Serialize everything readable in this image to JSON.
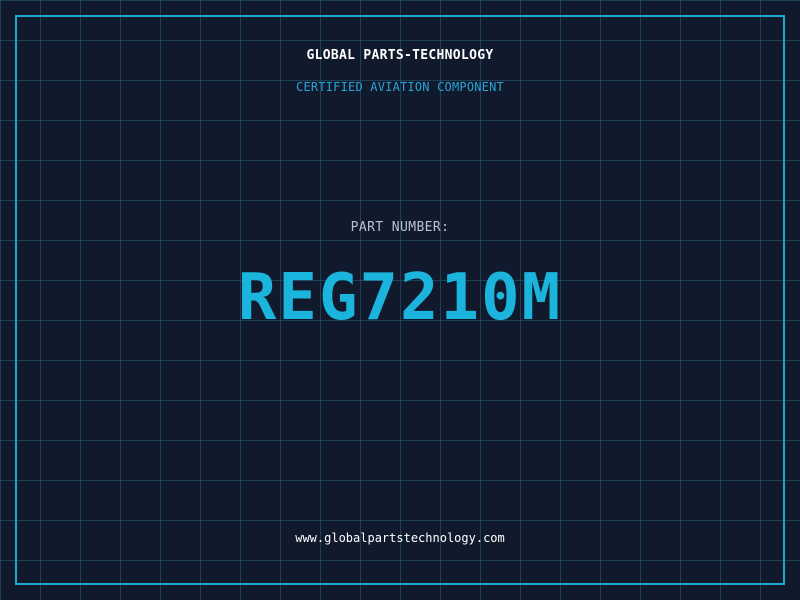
{
  "header": {
    "company": "GLOBAL PARTS-TECHNOLOGY",
    "tagline": "CERTIFIED AVIATION COMPONENT"
  },
  "part": {
    "label": "PART NUMBER:",
    "number": "REG7210M"
  },
  "footer": {
    "url": "www.globalpartstechnology.com"
  },
  "colors": {
    "background": "#111a2d",
    "grid": "#266078",
    "border": "#1fa6cf",
    "accent": "#1ab4dd",
    "tagline": "#29a3d6",
    "label": "#b9c3cf"
  }
}
